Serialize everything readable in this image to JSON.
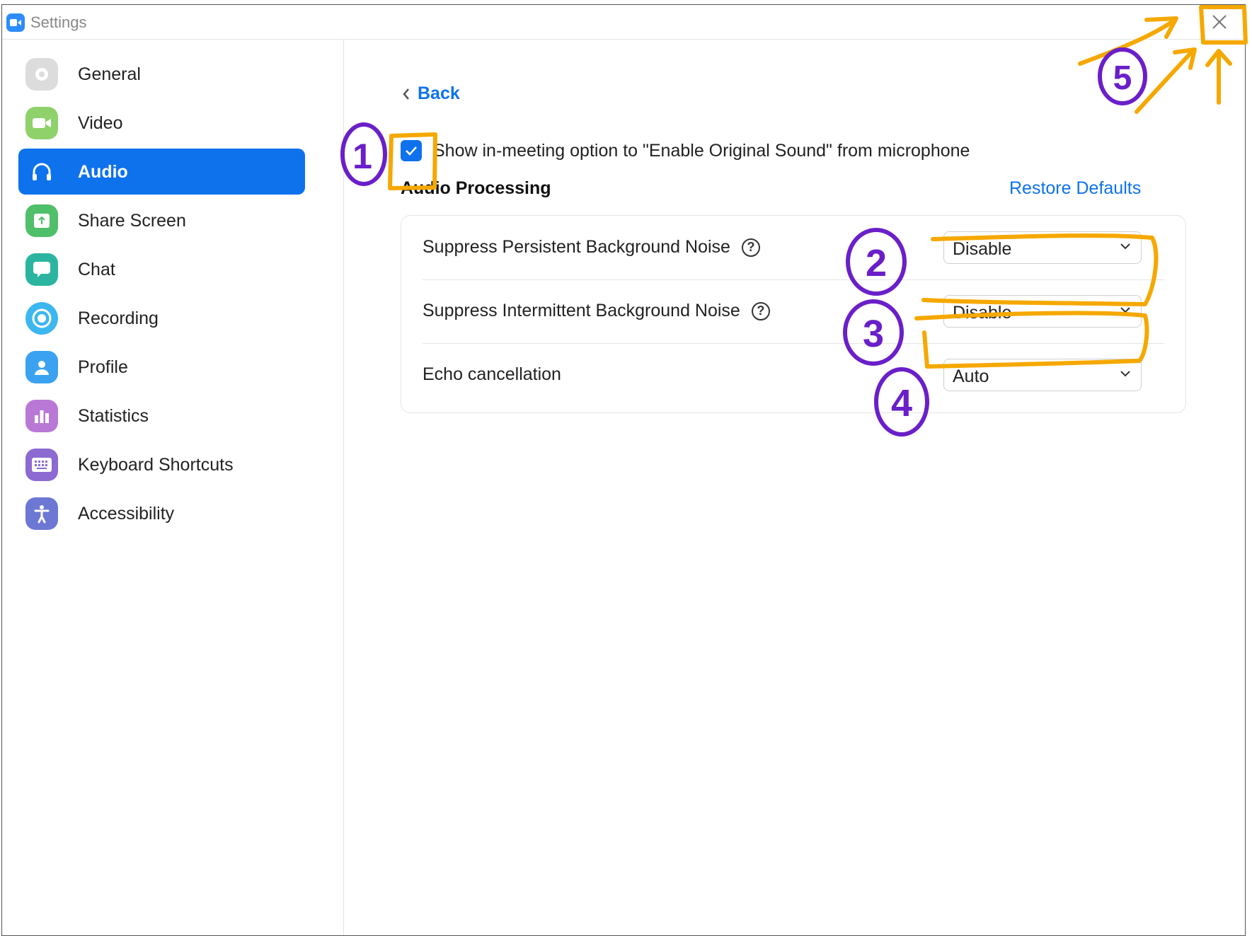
{
  "window": {
    "title": "Settings"
  },
  "sidebar": {
    "items": [
      {
        "label": "General",
        "icon": "gear-icon",
        "color": "#d6d6d6",
        "selected": false
      },
      {
        "label": "Video",
        "icon": "video-camera-icon",
        "color": "#8fd16a",
        "selected": false
      },
      {
        "label": "Audio",
        "icon": "headphones-icon",
        "color": "#0e72ed",
        "selected": true
      },
      {
        "label": "Share Screen",
        "icon": "share-screen-icon",
        "color": "#4fbf6a",
        "selected": false
      },
      {
        "label": "Chat",
        "icon": "chat-bubble-icon",
        "color": "#2bb5a0",
        "selected": false
      },
      {
        "label": "Recording",
        "icon": "record-icon",
        "color": "#3cb7f0",
        "selected": false
      },
      {
        "label": "Profile",
        "icon": "profile-icon",
        "color": "#3aa2f0",
        "selected": false
      },
      {
        "label": "Statistics",
        "icon": "bar-chart-icon",
        "color": "#b978d6",
        "selected": false
      },
      {
        "label": "Keyboard Shortcuts",
        "icon": "keyboard-icon",
        "color": "#8c6ad2",
        "selected": false
      },
      {
        "label": "Accessibility",
        "icon": "accessibility-icon",
        "color": "#6c78d4",
        "selected": false
      }
    ]
  },
  "main": {
    "back_label": "Back",
    "original_sound": {
      "checked": true,
      "label": "Show in-meeting option to \"Enable Original Sound\" from microphone"
    },
    "section_title": "Audio Processing",
    "restore_label": "Restore Defaults",
    "rows": [
      {
        "label": "Suppress Persistent Background Noise",
        "has_help": true,
        "value": "Disable"
      },
      {
        "label": "Suppress Intermittent Background Noise",
        "has_help": true,
        "value": "Disable"
      },
      {
        "label": "Echo cancellation",
        "has_help": false,
        "value": "Auto"
      }
    ]
  },
  "annotations": {
    "numbers": [
      "1",
      "2",
      "3",
      "4",
      "5"
    ],
    "highlight_color": "#f5a800",
    "number_color": "#6a1fc9"
  },
  "colors": {
    "accent": "#0e72ed"
  }
}
